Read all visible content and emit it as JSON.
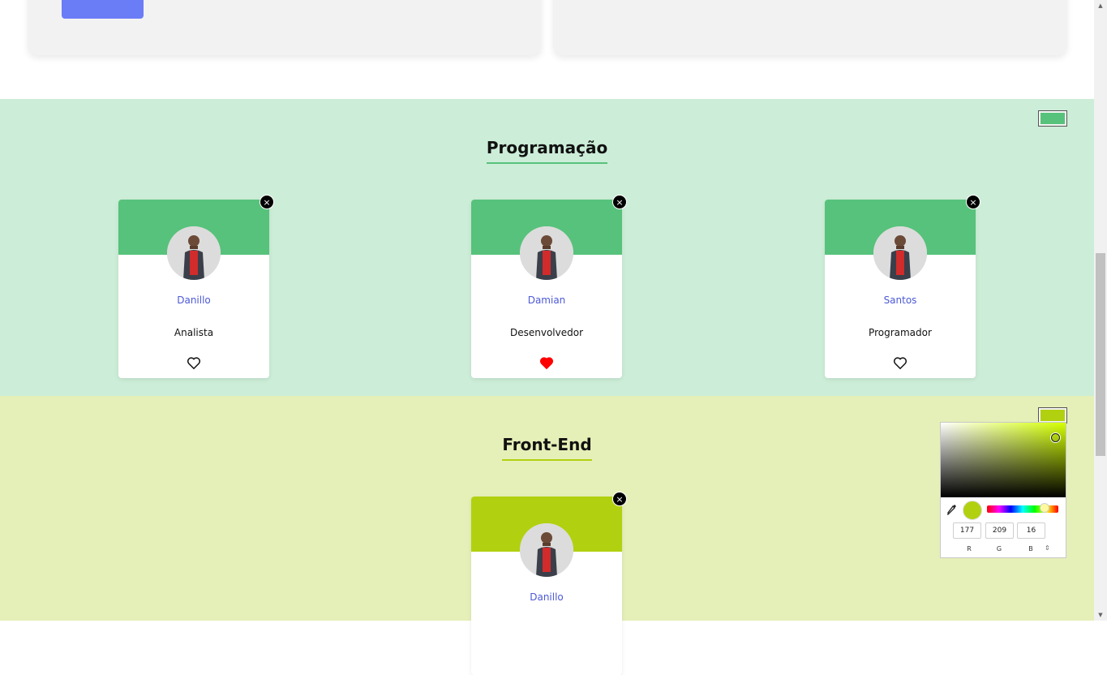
{
  "sections": [
    {
      "title": "Programação",
      "color": "#57c27b",
      "background": "#ccedd8",
      "cards": [
        {
          "name": "Danillo",
          "role": "Analista",
          "favorited": false
        },
        {
          "name": "Damian",
          "role": "Desenvolvedor",
          "favorited": true
        },
        {
          "name": "Santos",
          "role": "Programador",
          "favorited": false
        }
      ]
    },
    {
      "title": "Front-End",
      "color": "#b1d110",
      "background": "#e5efb8",
      "cards": [
        {
          "name": "Danillo",
          "role": "",
          "favorited": false
        }
      ]
    }
  ],
  "card_close_label": "×",
  "color_picker": {
    "rgb": {
      "r": "177",
      "g": "209",
      "b": "16"
    },
    "labels": {
      "r": "R",
      "g": "G",
      "b": "B"
    },
    "mode_toggle": "⇕",
    "current_color": "#b1d110"
  },
  "icons": {
    "heart_empty": "heart-outline-icon",
    "heart_filled": "heart-filled-icon",
    "close": "close-icon",
    "eyedropper": "eyedropper-icon"
  },
  "colors": {
    "accent_button": "#6b7cf7",
    "name_text": "#4c59d6",
    "heart_filled": "#ff0000"
  }
}
